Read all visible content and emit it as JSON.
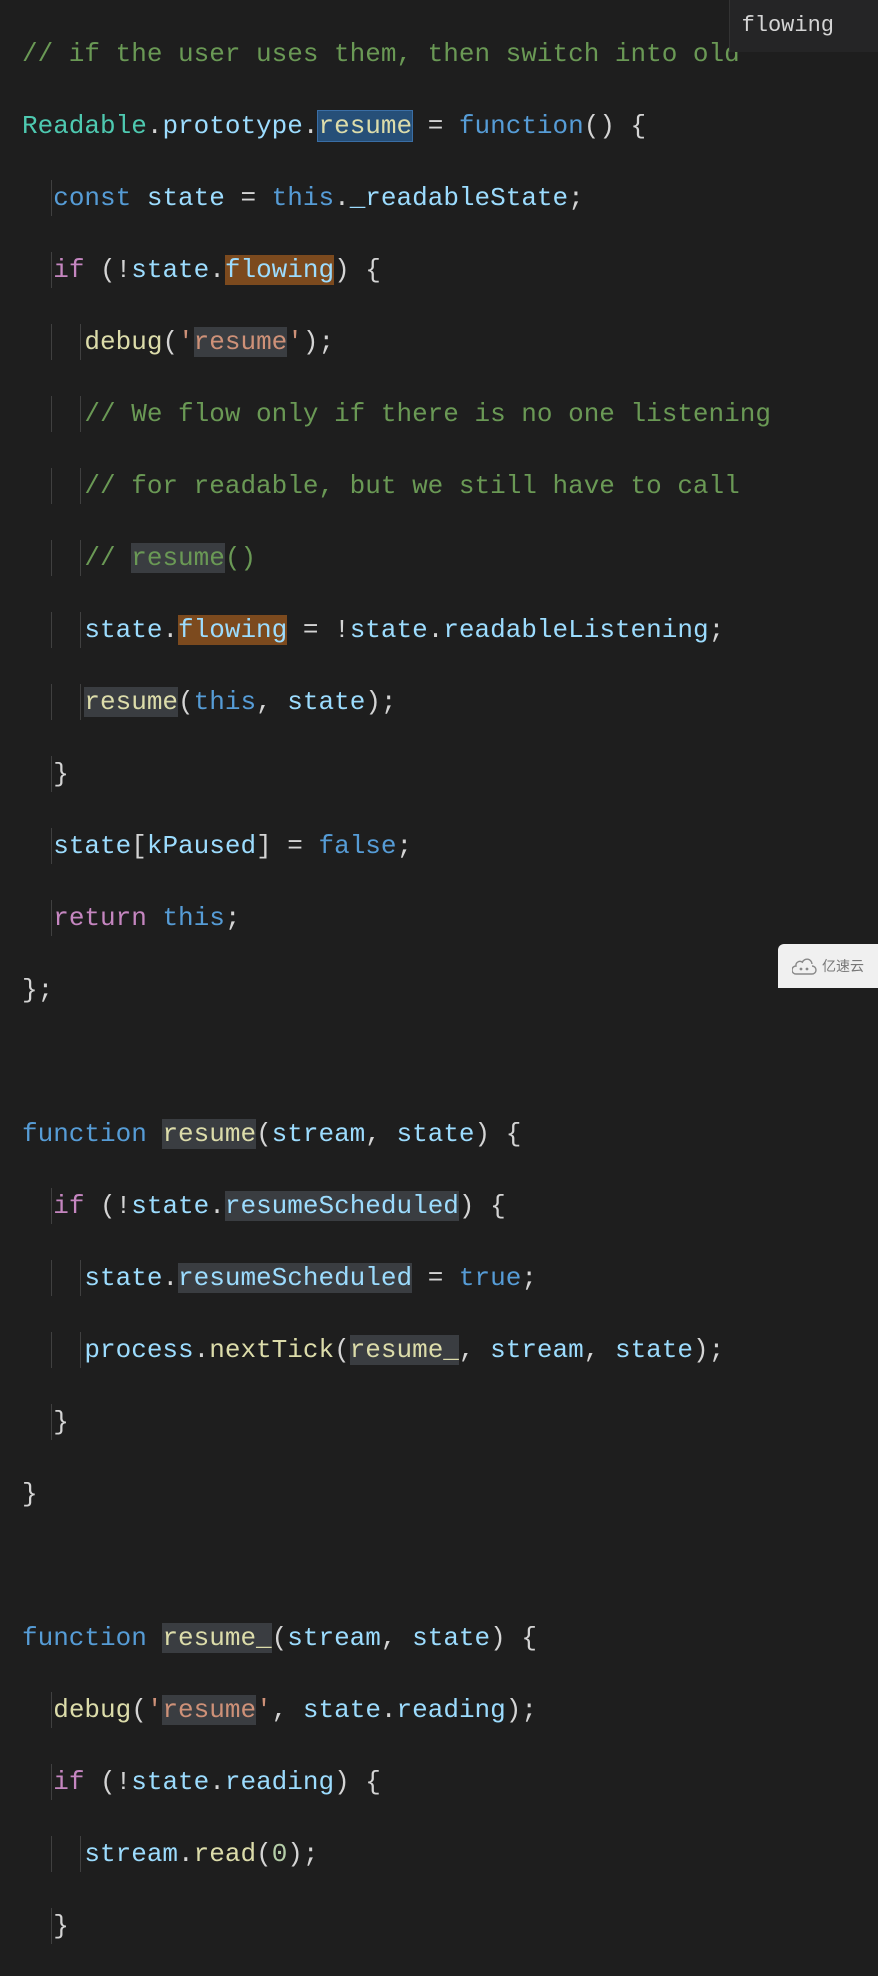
{
  "tooltip": {
    "text": "flowing"
  },
  "watermark": {
    "label": "亿速云"
  },
  "code": {
    "l0": "// if the user uses them, then switch into old",
    "l1": {
      "readable": "Readable",
      "proto": "prototype",
      "resume": "resume",
      "func": "function"
    },
    "l2": {
      "const": "const",
      "state": "state",
      "this": "this",
      "rs": "_readableState"
    },
    "l3": {
      "if": "if",
      "state": "state",
      "flowing": "flowing"
    },
    "l4": {
      "debug": "debug",
      "str": "'resume'"
    },
    "l5": "// We flow only if there is no one listening",
    "l6": "// for readable, but we still have to call",
    "l7a": "// ",
    "l7b": "resume",
    "l7c": "()",
    "l8": {
      "state": "state",
      "flowing": "flowing",
      "state2": "state",
      "rl": "readableListening"
    },
    "l9": {
      "resume": "resume",
      "this": "this",
      "state": "state"
    },
    "l11": {
      "state": "state",
      "kp": "kPaused",
      "false": "false"
    },
    "l12": {
      "return": "return",
      "this": "this"
    },
    "l15": {
      "func": "function",
      "resume": "resume",
      "stream": "stream",
      "state": "state"
    },
    "l16": {
      "if": "if",
      "state": "state",
      "rs": "resumeScheduled"
    },
    "l17": {
      "state": "state",
      "rs": "resumeScheduled",
      "true": "true"
    },
    "l18": {
      "proc": "process",
      "nt": "nextTick",
      "r": "resume_",
      "stream": "stream",
      "state": "state"
    },
    "l21": {
      "func": "function",
      "resume": "resume_",
      "stream": "stream",
      "state": "state"
    },
    "l22": {
      "debug": "debug",
      "str": "'resume'",
      "state": "state",
      "reading": "reading"
    },
    "l23": {
      "if": "if",
      "state": "state",
      "reading": "reading"
    },
    "l24": {
      "stream": "stream",
      "read": "read",
      "zero": "0"
    }
  }
}
